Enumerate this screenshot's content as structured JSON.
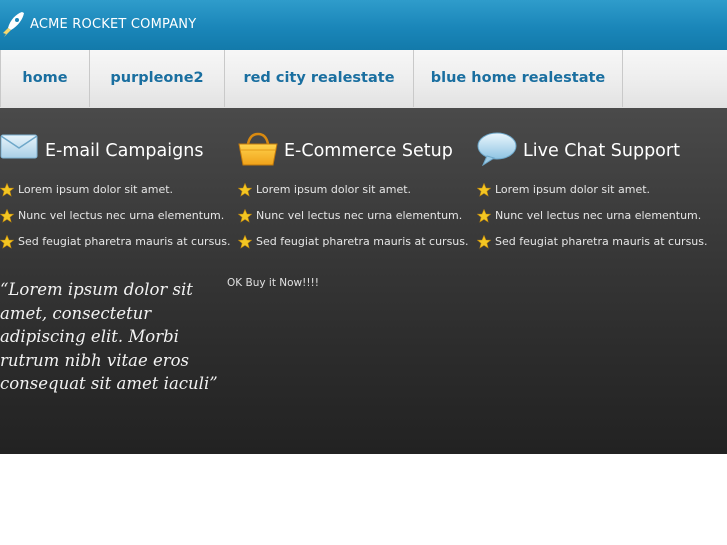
{
  "header": {
    "brand": "ACME ROCKET COMPANY",
    "logo_icon": "rocket-icon",
    "colors": {
      "bar": "#1a86b9",
      "text": "#ffffff"
    }
  },
  "nav": {
    "items": [
      {
        "label": "home"
      },
      {
        "label": "purpleone2"
      },
      {
        "label": "red city realestate"
      },
      {
        "label": "blue home realestate"
      }
    ],
    "link_color": "#1a6fa0"
  },
  "features": [
    {
      "icon": "envelope-icon",
      "title": "E-mail Campaigns",
      "items": [
        "Lorem ipsum dolor sit amet.",
        "Nunc vel lectus nec urna elementum.",
        "Sed feugiat pharetra mauris at cursus."
      ]
    },
    {
      "icon": "shopping-basket-icon",
      "title": "E-Commerce Setup",
      "items": [
        "Lorem ipsum dolor sit amet.",
        "Nunc vel lectus nec urna elementum.",
        "Sed feugiat pharetra mauris at cursus."
      ]
    },
    {
      "icon": "speech-bubble-icon",
      "title": "Live Chat Support",
      "items": [
        "Lorem ipsum dolor sit amet.",
        "Nunc vel lectus nec urna elementum.",
        "Sed feugiat pharetra mauris at cursus."
      ]
    }
  ],
  "bullet_icon": "star-icon",
  "quote": "“Lorem ipsum dolor sit amet, consectetur adipiscing elit. Morbi rutrum nibh vitae eros consequat sit amet iaculi”",
  "buy_text": "OK Buy it Now!!!!"
}
